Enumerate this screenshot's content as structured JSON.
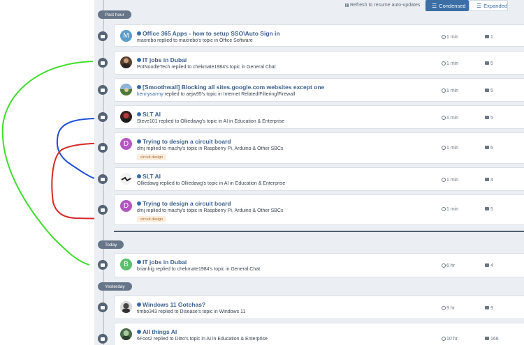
{
  "toolbar": {
    "refresh_label": "Refresh to resume auto-updates",
    "condensed_label": "Condensed",
    "expanded_label": "Expanded"
  },
  "colors": {
    "accent": "#3a6ea5",
    "pill": "#667588",
    "tag_bg": "#fbeedd",
    "tag_text": "#b1652a",
    "annotation_green": "#3fdd2e",
    "annotation_blue": "#1f4fd6",
    "annotation_red": "#d62828"
  },
  "sections": {
    "past_hour": "Past hour",
    "today": "Today",
    "yesterday": "Yesterday"
  },
  "topics": [
    {
      "title": "Office 365 Apps - how to setup SSO\\Auto Sign in",
      "user": "maxrebo",
      "meta_rest": " replied to maxrebo's topic in Office Software",
      "time": "1 min",
      "replies": "1",
      "avatar": "M",
      "avatar_color": "#5c9dc9"
    },
    {
      "title": "IT jobs in Dubai",
      "user": "PotNoodleTech",
      "meta_rest": " replied to chekmate1984's topic in General Chat",
      "time": "1 min",
      "replies": "5",
      "avatar_icon": "photo-avatar"
    },
    {
      "title": "[Smoothwall] Blocking all sites.google.com websites except one",
      "user": "kennysarmy",
      "meta_rest": " replied to aejw95's topic in Internet Related/Filtering/Firewall",
      "time": "1 min",
      "replies": "5",
      "avatar_icon": "photo-avatar"
    },
    {
      "title": "SLT AI",
      "user": "Steve101",
      "meta_rest": " replied to Olliedawg's topic in AI in Education & Enterprise",
      "time": "1 min",
      "replies": "5",
      "avatar_icon": "photo-avatar"
    },
    {
      "title": "Trying to design a circuit board",
      "user": "dmj",
      "meta_rest": " replied to machy's topic in Raspberry Pi, Arduino & Other SBCs",
      "tag": "circuit design",
      "time": "1 min",
      "replies": "6",
      "avatar": "D",
      "avatar_color": "#b456c0"
    },
    {
      "title": "SLT AI",
      "user": "Olliedawg",
      "meta_rest": " replied to Olliedawg's topic in AI in Education & Enterprise",
      "time": "1 min",
      "replies": "4",
      "avatar_icon": "photo-avatar"
    },
    {
      "title": "Trying to design a circuit board",
      "user": "dmj",
      "meta_rest": " replied to machy's topic in Raspberry Pi, Arduino & Other SBCs",
      "tag": "circuit design",
      "time": "1 min",
      "replies": "5",
      "avatar": "D",
      "avatar_color": "#b456c0"
    },
    {
      "title": "IT jobs in Dubai",
      "user": "brianhig",
      "meta_rest": " replied to chekmate1984's topic in General Chat",
      "time": "6 hr",
      "replies": "4",
      "avatar": "B",
      "avatar_color": "#5bbf6e"
    },
    {
      "title": "Windows 11 Gotchas?",
      "user": "timbo343",
      "meta_rest": " replied to Disease's topic in Windows 11",
      "time": "9 hr",
      "replies": "9",
      "avatar_icon": "photo-avatar"
    },
    {
      "title": "All things AI",
      "user": "6Foot2",
      "meta_rest": " replied to Ditto's topic in AI in Education & Enterprise",
      "time": "10 hr",
      "replies": "166",
      "avatar_icon": "photo-avatar"
    }
  ]
}
